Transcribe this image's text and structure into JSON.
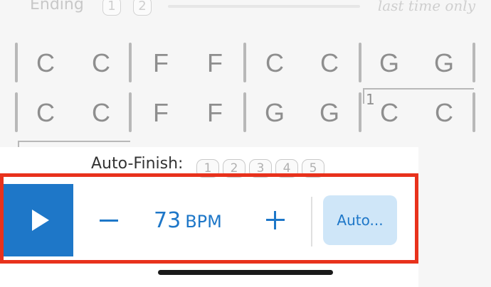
{
  "ending": {
    "label": "Ending",
    "badges": [
      "1",
      "2"
    ],
    "note": "last time only"
  },
  "chord_rows": [
    [
      "C",
      "C",
      "F",
      "F",
      "C",
      "C",
      "G",
      "G"
    ],
    [
      "C",
      "C",
      "F",
      "F",
      "G",
      "G",
      "C",
      "C"
    ]
  ],
  "ending_marker": "1",
  "auto_finish": {
    "label": "Auto-Finish:",
    "options": [
      "1",
      "2",
      "3",
      "4",
      "5"
    ]
  },
  "controls": {
    "tempo_value": "73",
    "tempo_unit": "BPM",
    "auto_label": "Auto..."
  },
  "colors": {
    "accent": "#1e77c8",
    "auto_bg": "#cfe6f8",
    "highlight": "#e8321c"
  }
}
